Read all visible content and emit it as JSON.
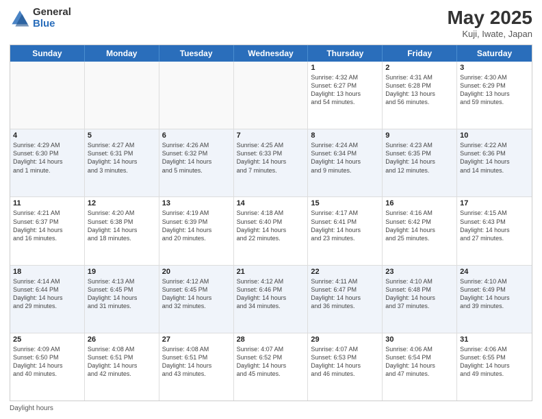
{
  "logo": {
    "general": "General",
    "blue": "Blue"
  },
  "title": {
    "month_year": "May 2025",
    "location": "Kuji, Iwate, Japan"
  },
  "header_days": [
    "Sunday",
    "Monday",
    "Tuesday",
    "Wednesday",
    "Thursday",
    "Friday",
    "Saturday"
  ],
  "weeks": [
    [
      {
        "day": "",
        "info": "",
        "empty": true
      },
      {
        "day": "",
        "info": "",
        "empty": true
      },
      {
        "day": "",
        "info": "",
        "empty": true
      },
      {
        "day": "",
        "info": "",
        "empty": true
      },
      {
        "day": "1",
        "info": "Sunrise: 4:32 AM\nSunset: 6:27 PM\nDaylight: 13 hours\nand 54 minutes.",
        "empty": false
      },
      {
        "day": "2",
        "info": "Sunrise: 4:31 AM\nSunset: 6:28 PM\nDaylight: 13 hours\nand 56 minutes.",
        "empty": false
      },
      {
        "day": "3",
        "info": "Sunrise: 4:30 AM\nSunset: 6:29 PM\nDaylight: 13 hours\nand 59 minutes.",
        "empty": false
      }
    ],
    [
      {
        "day": "4",
        "info": "Sunrise: 4:29 AM\nSunset: 6:30 PM\nDaylight: 14 hours\nand 1 minute.",
        "empty": false
      },
      {
        "day": "5",
        "info": "Sunrise: 4:27 AM\nSunset: 6:31 PM\nDaylight: 14 hours\nand 3 minutes.",
        "empty": false
      },
      {
        "day": "6",
        "info": "Sunrise: 4:26 AM\nSunset: 6:32 PM\nDaylight: 14 hours\nand 5 minutes.",
        "empty": false
      },
      {
        "day": "7",
        "info": "Sunrise: 4:25 AM\nSunset: 6:33 PM\nDaylight: 14 hours\nand 7 minutes.",
        "empty": false
      },
      {
        "day": "8",
        "info": "Sunrise: 4:24 AM\nSunset: 6:34 PM\nDaylight: 14 hours\nand 9 minutes.",
        "empty": false
      },
      {
        "day": "9",
        "info": "Sunrise: 4:23 AM\nSunset: 6:35 PM\nDaylight: 14 hours\nand 12 minutes.",
        "empty": false
      },
      {
        "day": "10",
        "info": "Sunrise: 4:22 AM\nSunset: 6:36 PM\nDaylight: 14 hours\nand 14 minutes.",
        "empty": false
      }
    ],
    [
      {
        "day": "11",
        "info": "Sunrise: 4:21 AM\nSunset: 6:37 PM\nDaylight: 14 hours\nand 16 minutes.",
        "empty": false
      },
      {
        "day": "12",
        "info": "Sunrise: 4:20 AM\nSunset: 6:38 PM\nDaylight: 14 hours\nand 18 minutes.",
        "empty": false
      },
      {
        "day": "13",
        "info": "Sunrise: 4:19 AM\nSunset: 6:39 PM\nDaylight: 14 hours\nand 20 minutes.",
        "empty": false
      },
      {
        "day": "14",
        "info": "Sunrise: 4:18 AM\nSunset: 6:40 PM\nDaylight: 14 hours\nand 22 minutes.",
        "empty": false
      },
      {
        "day": "15",
        "info": "Sunrise: 4:17 AM\nSunset: 6:41 PM\nDaylight: 14 hours\nand 23 minutes.",
        "empty": false
      },
      {
        "day": "16",
        "info": "Sunrise: 4:16 AM\nSunset: 6:42 PM\nDaylight: 14 hours\nand 25 minutes.",
        "empty": false
      },
      {
        "day": "17",
        "info": "Sunrise: 4:15 AM\nSunset: 6:43 PM\nDaylight: 14 hours\nand 27 minutes.",
        "empty": false
      }
    ],
    [
      {
        "day": "18",
        "info": "Sunrise: 4:14 AM\nSunset: 6:44 PM\nDaylight: 14 hours\nand 29 minutes.",
        "empty": false
      },
      {
        "day": "19",
        "info": "Sunrise: 4:13 AM\nSunset: 6:45 PM\nDaylight: 14 hours\nand 31 minutes.",
        "empty": false
      },
      {
        "day": "20",
        "info": "Sunrise: 4:12 AM\nSunset: 6:45 PM\nDaylight: 14 hours\nand 32 minutes.",
        "empty": false
      },
      {
        "day": "21",
        "info": "Sunrise: 4:12 AM\nSunset: 6:46 PM\nDaylight: 14 hours\nand 34 minutes.",
        "empty": false
      },
      {
        "day": "22",
        "info": "Sunrise: 4:11 AM\nSunset: 6:47 PM\nDaylight: 14 hours\nand 36 minutes.",
        "empty": false
      },
      {
        "day": "23",
        "info": "Sunrise: 4:10 AM\nSunset: 6:48 PM\nDaylight: 14 hours\nand 37 minutes.",
        "empty": false
      },
      {
        "day": "24",
        "info": "Sunrise: 4:10 AM\nSunset: 6:49 PM\nDaylight: 14 hours\nand 39 minutes.",
        "empty": false
      }
    ],
    [
      {
        "day": "25",
        "info": "Sunrise: 4:09 AM\nSunset: 6:50 PM\nDaylight: 14 hours\nand 40 minutes.",
        "empty": false
      },
      {
        "day": "26",
        "info": "Sunrise: 4:08 AM\nSunset: 6:51 PM\nDaylight: 14 hours\nand 42 minutes.",
        "empty": false
      },
      {
        "day": "27",
        "info": "Sunrise: 4:08 AM\nSunset: 6:51 PM\nDaylight: 14 hours\nand 43 minutes.",
        "empty": false
      },
      {
        "day": "28",
        "info": "Sunrise: 4:07 AM\nSunset: 6:52 PM\nDaylight: 14 hours\nand 45 minutes.",
        "empty": false
      },
      {
        "day": "29",
        "info": "Sunrise: 4:07 AM\nSunset: 6:53 PM\nDaylight: 14 hours\nand 46 minutes.",
        "empty": false
      },
      {
        "day": "30",
        "info": "Sunrise: 4:06 AM\nSunset: 6:54 PM\nDaylight: 14 hours\nand 47 minutes.",
        "empty": false
      },
      {
        "day": "31",
        "info": "Sunrise: 4:06 AM\nSunset: 6:55 PM\nDaylight: 14 hours\nand 49 minutes.",
        "empty": false
      }
    ]
  ],
  "footer": {
    "daylight_hours": "Daylight hours"
  }
}
